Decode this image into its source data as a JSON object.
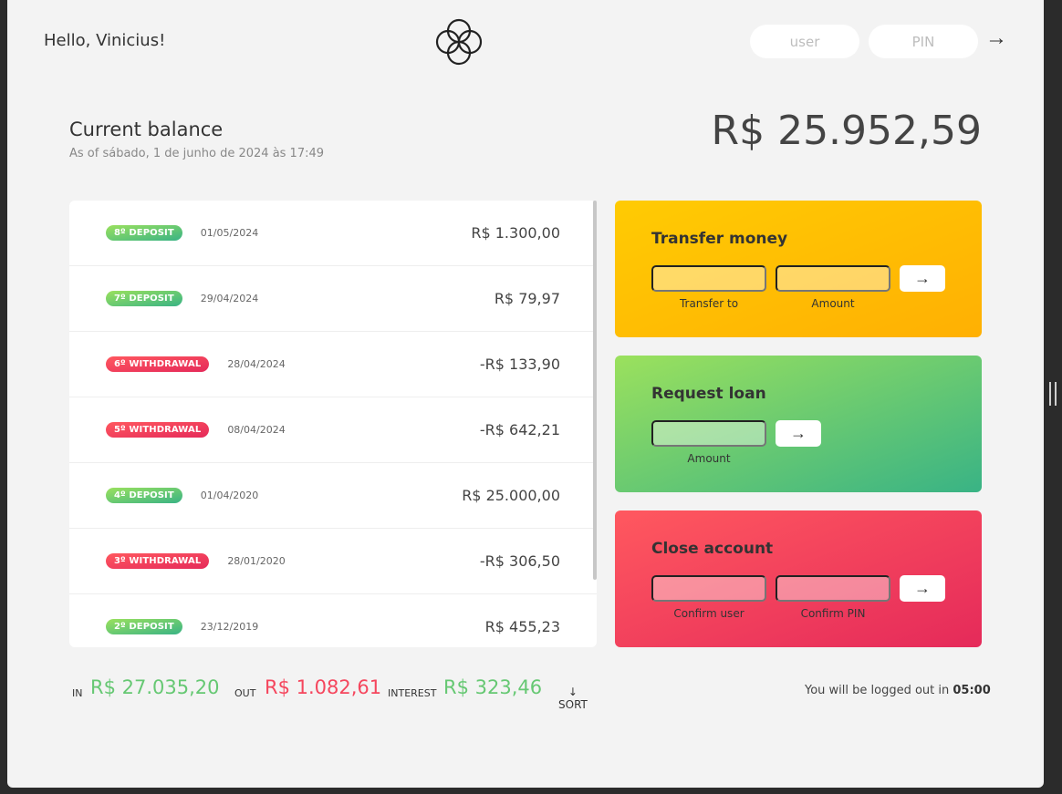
{
  "nav": {
    "welcome": "Hello, Vinicius!",
    "user_placeholder": "user",
    "pin_placeholder": "PIN",
    "login_icon": "arrow-right-icon"
  },
  "balance": {
    "label": "Current balance",
    "date": "As of sábado, 1 de junho de 2024 às 17:49",
    "value": "R$ 25.952,59"
  },
  "movements": [
    {
      "type_label": "8º DEPOSIT",
      "kind": "deposit",
      "date": "01/05/2024",
      "value": "R$ 1.300,00"
    },
    {
      "type_label": "7º DEPOSIT",
      "kind": "deposit",
      "date": "29/04/2024",
      "value": "R$ 79,97"
    },
    {
      "type_label": "6º WITHDRAWAL",
      "kind": "withdrawal",
      "date": "28/04/2024",
      "value": "-R$ 133,90"
    },
    {
      "type_label": "5º WITHDRAWAL",
      "kind": "withdrawal",
      "date": "08/04/2024",
      "value": "-R$ 642,21"
    },
    {
      "type_label": "4º DEPOSIT",
      "kind": "deposit",
      "date": "01/04/2020",
      "value": "R$ 25.000,00"
    },
    {
      "type_label": "3º WITHDRAWAL",
      "kind": "withdrawal",
      "date": "28/01/2020",
      "value": "-R$ 306,50"
    },
    {
      "type_label": "2º DEPOSIT",
      "kind": "deposit",
      "date": "23/12/2019",
      "value": "R$ 455,23"
    }
  ],
  "operations": {
    "transfer": {
      "title": "Transfer money",
      "label_to": "Transfer to",
      "label_amount": "Amount"
    },
    "loan": {
      "title": "Request loan",
      "label_amount": "Amount"
    },
    "close": {
      "title": "Close account",
      "label_user": "Confirm user",
      "label_pin": "Confirm PIN"
    },
    "button_glyph": "→"
  },
  "summary": {
    "in_label": "In",
    "in_value": "R$ 27.035,20",
    "out_label": "Out",
    "out_value": "R$ 1.082,61",
    "interest_label": "Interest",
    "interest_value": "R$ 323,46",
    "sort_arrow": "↓",
    "sort_label": "SORT"
  },
  "logout": {
    "text": "You will be logged out in",
    "time": "05:00"
  },
  "colors": {
    "deposit": "#66c873",
    "withdrawal": "#f5465d",
    "transfer_card": "#ffb003",
    "loan_card": "#39b385",
    "close_card": "#e52a5a"
  }
}
